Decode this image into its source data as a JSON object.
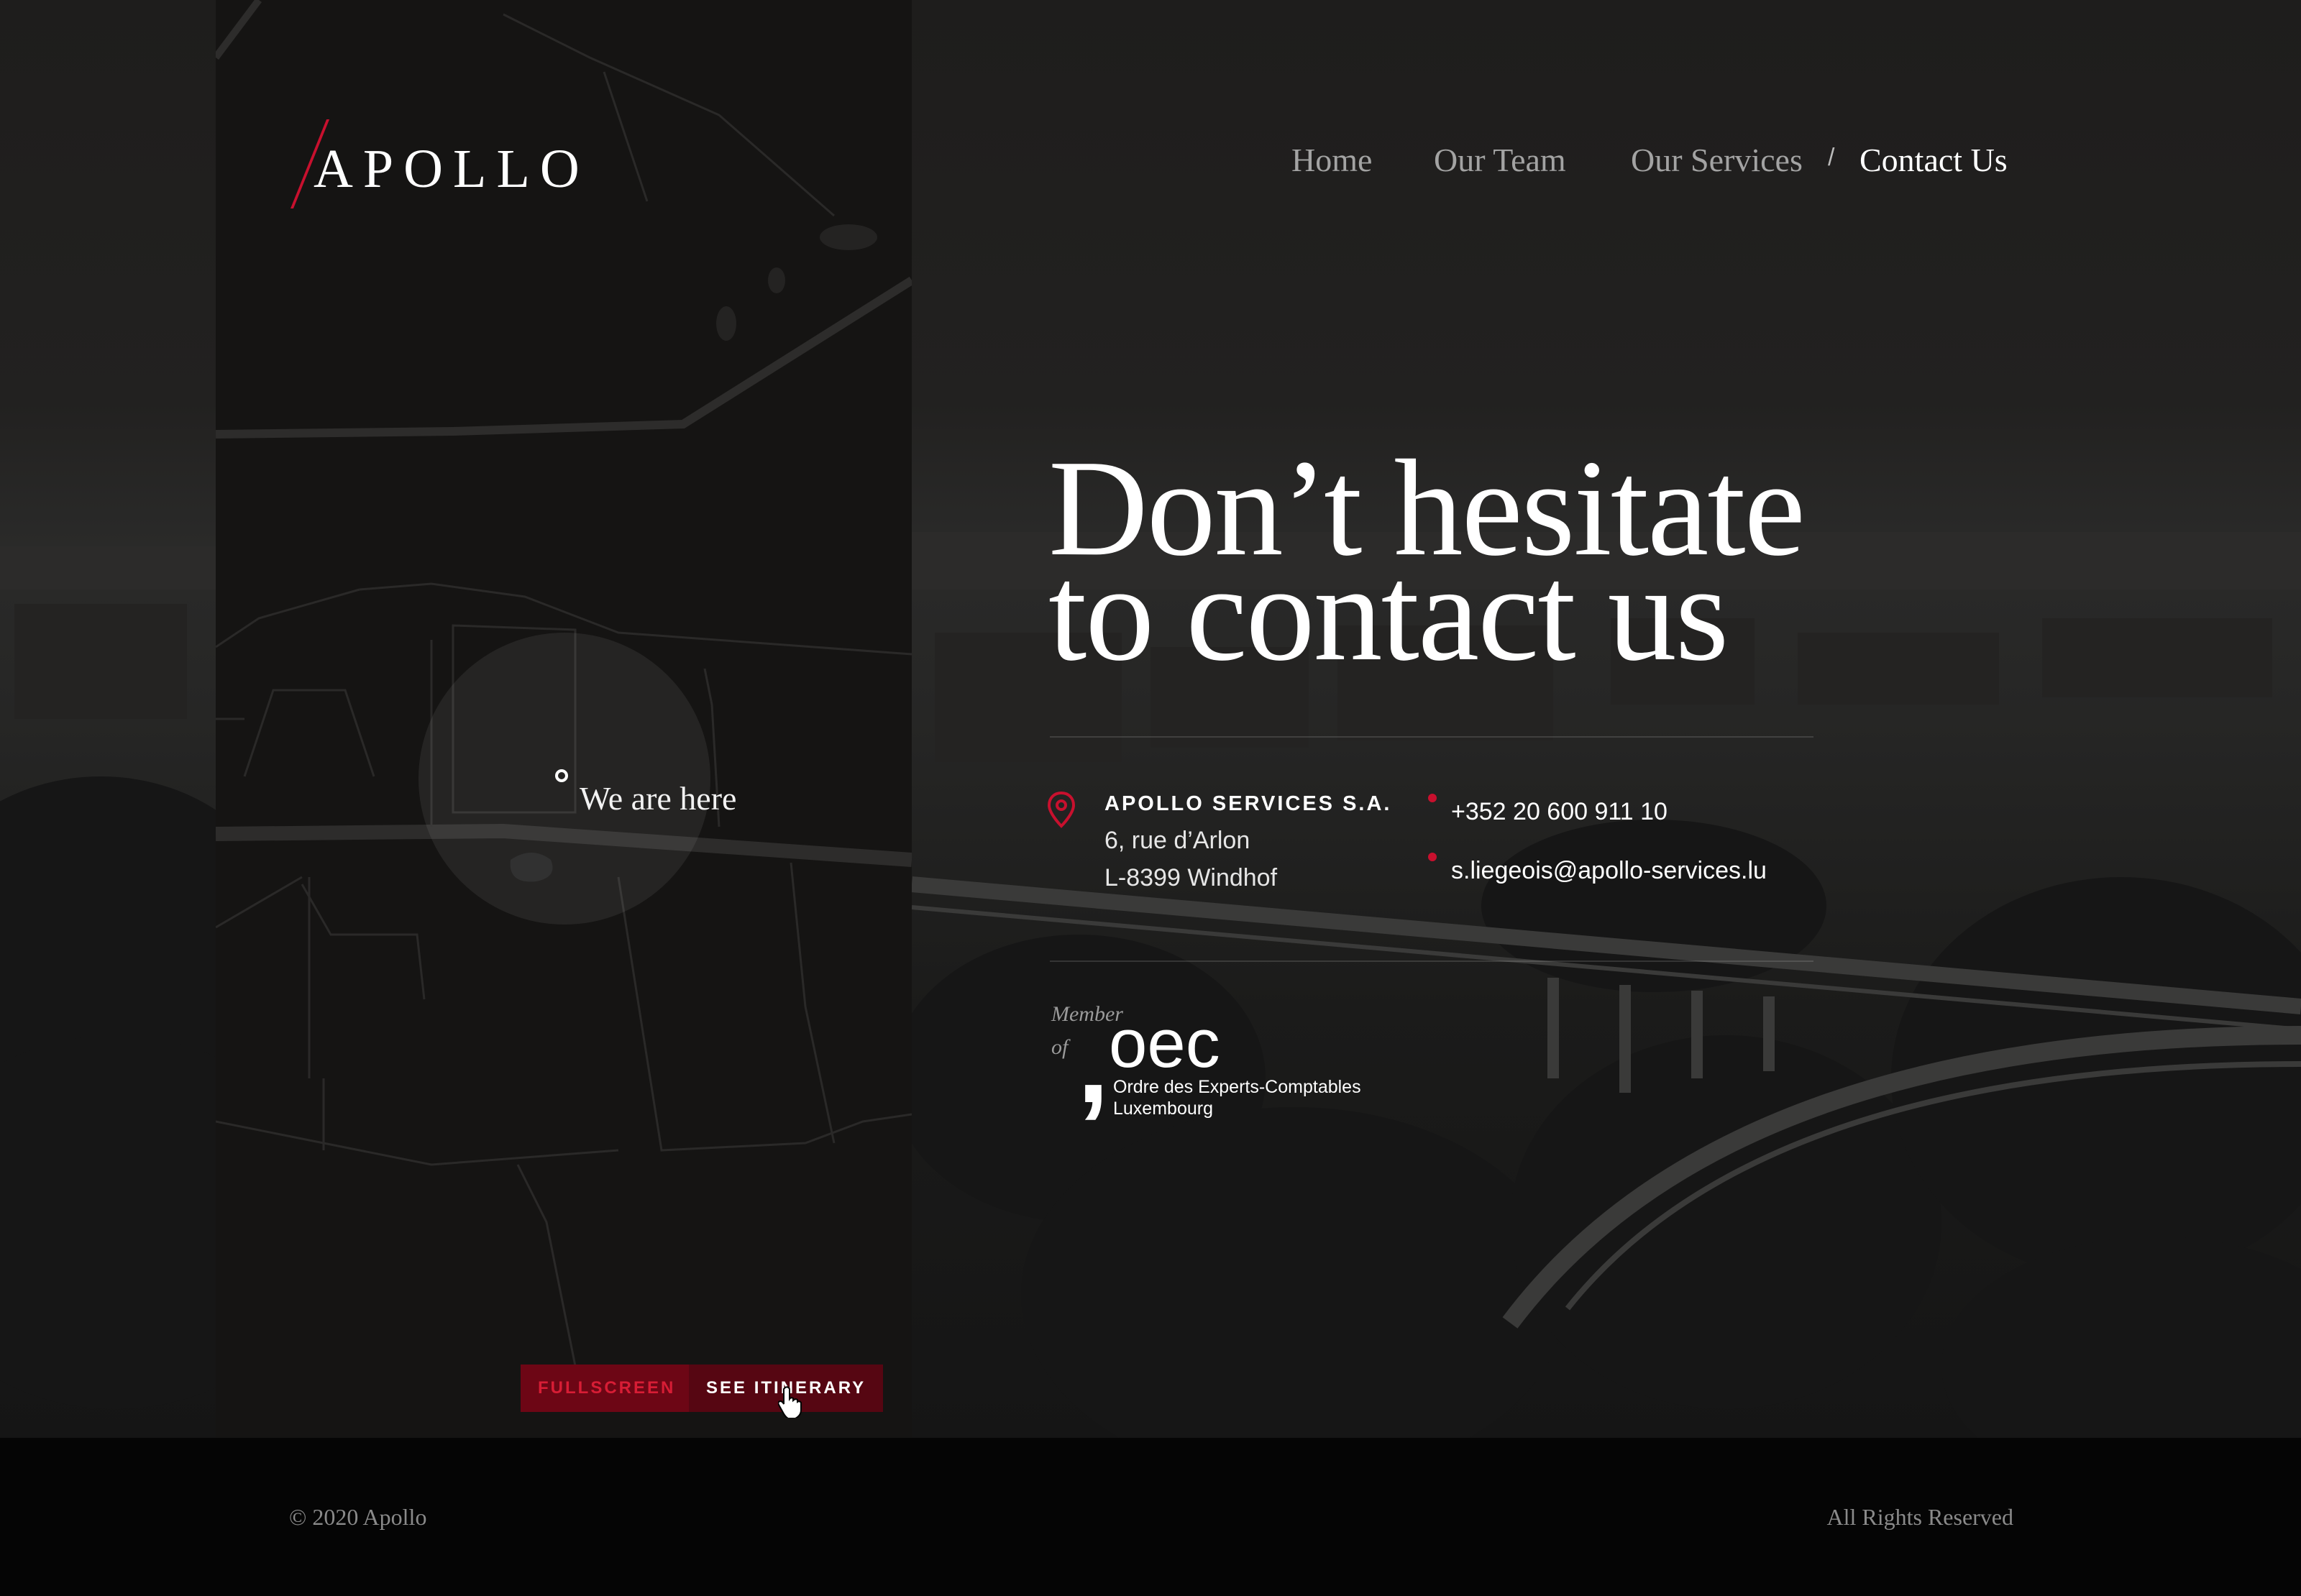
{
  "brand": {
    "logo_text": "APOLLO",
    "accent_color": "#c8102e"
  },
  "nav": {
    "items": [
      {
        "label": "Home"
      },
      {
        "label": "Our Team"
      },
      {
        "label": "Our Services"
      }
    ],
    "separator": "/",
    "active": {
      "label": "Contact Us"
    }
  },
  "map": {
    "marker_label": "We are here",
    "fullscreen_label": "FULLSCREEN",
    "itinerary_label": "SEE ITINERARY"
  },
  "hero": {
    "title_line1": "Don’t hesitate",
    "title_line2": "to contact us"
  },
  "address": {
    "company": "APOLLO SERVICES S.A.",
    "street": "6, rue d’Arlon",
    "city": "L-8399 Windhof",
    "icon": "location-pin-icon"
  },
  "contact": {
    "phone": "+352 20 600 911 10",
    "email": "s.liegeois@apollo-services.lu"
  },
  "membership": {
    "line1": "Member",
    "line2": "of",
    "org_mark": ",",
    "org_short": "oec",
    "org_name": "Ordre des Experts-Comptables",
    "org_country": "Luxembourg"
  },
  "footer": {
    "copyright": "© 2020 Apollo",
    "rights": "All Rights Reserved"
  }
}
